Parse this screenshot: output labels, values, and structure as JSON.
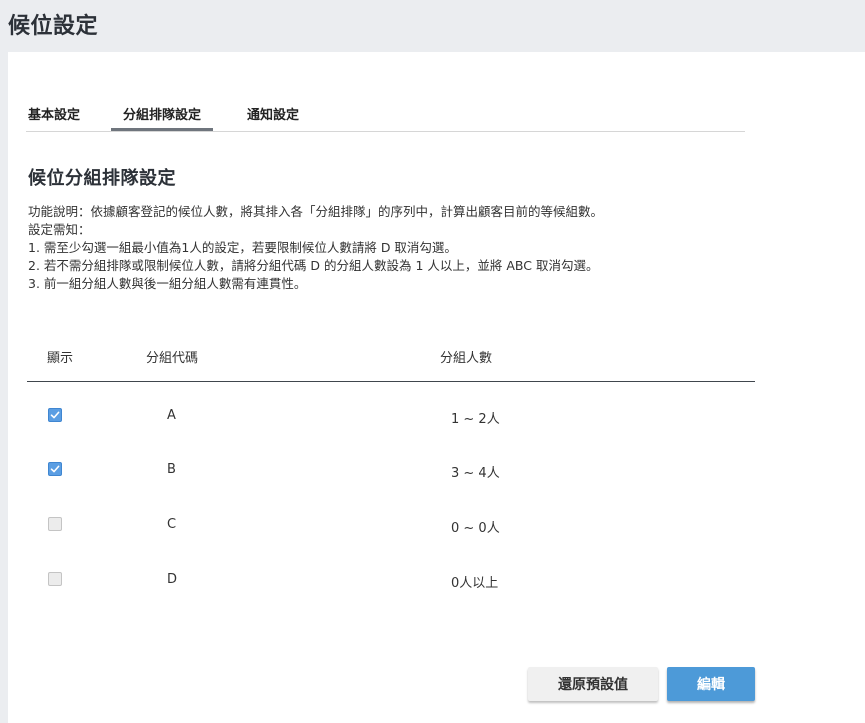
{
  "page": {
    "title": "候位設定"
  },
  "tabs": [
    {
      "label": "基本設定",
      "active": false
    },
    {
      "label": "分組排隊設定",
      "active": true
    },
    {
      "label": "通知設定",
      "active": false
    }
  ],
  "section": {
    "title": "候位分組排隊設定",
    "description": [
      "功能說明：依據顧客登記的候位人數，將其排入各「分組排隊」的序列中，計算出顧客目前的等候組數。",
      "設定需知：",
      "1. 需至少勾選一組最小值為1人的設定，若要限制候位人數請將 D 取消勾選。",
      "2. 若不需分組排隊或限制候位人數，請將分組代碼 D 的分組人數設為 1 人以上，並將 ABC 取消勾選。",
      "3. 前一組分組人數與後一組分組人數需有連貫性。"
    ]
  },
  "table": {
    "headers": {
      "show": "顯示",
      "code": "分組代碼",
      "count": "分組人數"
    },
    "rows": [
      {
        "checked": true,
        "code": "A",
        "range": "1 ~ 2人"
      },
      {
        "checked": true,
        "code": "B",
        "range": "3 ~ 4人"
      },
      {
        "checked": false,
        "code": "C",
        "range": "0 ~ 0人"
      },
      {
        "checked": false,
        "code": "D",
        "range": "0人以上"
      }
    ]
  },
  "buttons": {
    "reset_label": "還原預設值",
    "edit_label": "編輯"
  },
  "colors": {
    "accent": "#4d9ad8",
    "checkbox_checked": "#5b9ee3",
    "tab_underline": "#6f757d"
  }
}
